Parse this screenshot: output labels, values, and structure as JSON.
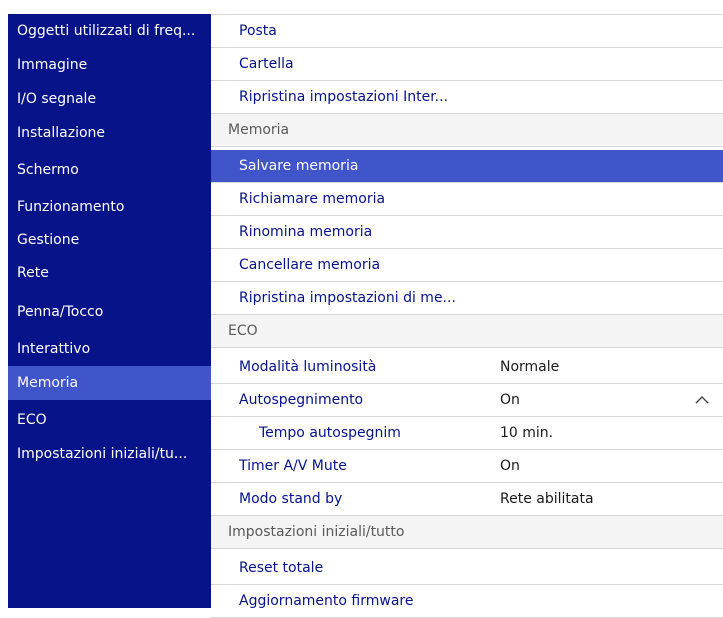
{
  "sidebar": {
    "items": [
      {
        "label": "Oggetti utilizzati di freq..."
      },
      {
        "label": "Immagine"
      },
      {
        "label": "I/O segnale"
      },
      {
        "label": "Installazione"
      },
      {
        "label": "Schermo"
      },
      {
        "label": "Funzionamento"
      },
      {
        "label": "Gestione"
      },
      {
        "label": "Rete"
      },
      {
        "label": "Penna/Tocco"
      },
      {
        "label": "Interattivo"
      },
      {
        "label": "Memoria",
        "selected": true
      },
      {
        "label": "ECO"
      },
      {
        "label": "Impostazioni iniziali/tu..."
      }
    ]
  },
  "panel": {
    "top_items": [
      {
        "label": "Posta"
      },
      {
        "label": "Cartella"
      },
      {
        "label": "Ripristina impostazioni Inter..."
      }
    ],
    "memoria": {
      "header": "Memoria",
      "items": [
        {
          "label": "Salvare memoria",
          "selected": true
        },
        {
          "label": "Richiamare memoria"
        },
        {
          "label": "Rinomina memoria"
        },
        {
          "label": "Cancellare memoria"
        },
        {
          "label": "Ripristina impostazioni di me..."
        }
      ]
    },
    "eco": {
      "header": "ECO",
      "items": [
        {
          "label": "Modalità luminosità",
          "value": "Normale"
        },
        {
          "label": "Autospegnimento",
          "value": "On",
          "icon": "chevron-up-icon"
        },
        {
          "label": "Tempo autospegnim",
          "value": "10 min."
        },
        {
          "label": "Timer A/V Mute",
          "value": "On"
        },
        {
          "label": "Modo stand by",
          "value": "Rete abilitata"
        }
      ]
    },
    "impostazioni": {
      "header": "Impostazioni iniziali/tutto",
      "items": [
        {
          "label": "Reset totale"
        },
        {
          "label": "Aggiornamento firmware"
        }
      ]
    }
  },
  "colors": {
    "sidebar_bg": "#071389",
    "selection": "#3f55c9",
    "item_text": "#071389",
    "section_bg": "#f4f4f4"
  }
}
